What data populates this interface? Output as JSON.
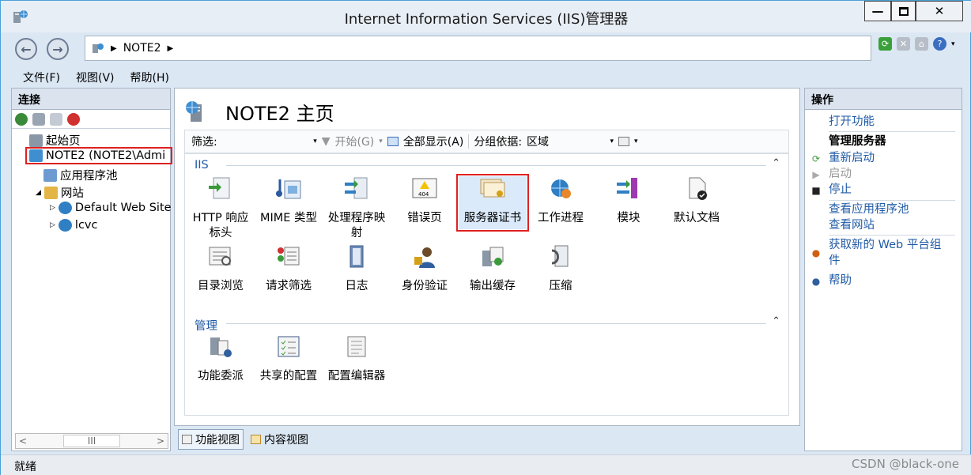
{
  "window": {
    "title": "Internet Information Services (IIS)管理器"
  },
  "nav": {
    "path_item": "NOTE2"
  },
  "menu": [
    "文件(F)",
    "视图(V)",
    "帮助(H)"
  ],
  "connections": {
    "title": "连接",
    "tree": [
      {
        "label": "起始页"
      },
      {
        "label": "NOTE2 (NOTE2\\Admi"
      },
      {
        "label": "应用程序池"
      },
      {
        "label": "网站"
      },
      {
        "label": "Default Web Site"
      },
      {
        "label": "lcvc"
      }
    ],
    "scroll_label": "III"
  },
  "main": {
    "title": "NOTE2 主页",
    "filter": {
      "label": "筛选:",
      "start": "开始(G)",
      "show_all": "全部显示(A)",
      "group_by_label": "分组依据:",
      "group_by_value": "区域"
    },
    "groups": [
      {
        "name": "IIS"
      },
      {
        "name": "管理"
      }
    ],
    "features": [
      {
        "label": "HTTP 响应\n标头",
        "icon": "http-headers-icon"
      },
      {
        "label": "MIME 类型",
        "icon": "mime-types-icon"
      },
      {
        "label": "处理程序映\n射",
        "icon": "handler-mappings-icon"
      },
      {
        "label": "错误页",
        "icon": "error-pages-icon"
      },
      {
        "label": "服务器证书",
        "icon": "server-certificates-icon"
      },
      {
        "label": "工作进程",
        "icon": "worker-processes-icon"
      },
      {
        "label": "模块",
        "icon": "modules-icon"
      },
      {
        "label": "默认文档",
        "icon": "default-document-icon"
      },
      {
        "label": "目录浏览",
        "icon": "directory-browsing-icon"
      },
      {
        "label": "请求筛选",
        "icon": "request-filtering-icon"
      },
      {
        "label": "日志",
        "icon": "logging-icon"
      },
      {
        "label": "身份验证",
        "icon": "authentication-icon"
      },
      {
        "label": "输出缓存",
        "icon": "output-caching-icon"
      },
      {
        "label": "压缩",
        "icon": "compression-icon"
      },
      {
        "label": "功能委派",
        "icon": "feature-delegation-icon"
      },
      {
        "label": "共享的配置",
        "icon": "shared-configuration-icon"
      },
      {
        "label": "配置编辑器",
        "icon": "configuration-editor-icon"
      }
    ],
    "tabs": [
      "功能视图",
      "内容视图"
    ]
  },
  "actions": {
    "title": "操作",
    "items": [
      {
        "label": "打开功能"
      },
      {
        "label": "管理服务器"
      },
      {
        "label": "重新启动"
      },
      {
        "label": "启动"
      },
      {
        "label": "停止"
      },
      {
        "label": "查看应用程序池"
      },
      {
        "label": "查看网站"
      },
      {
        "label": "获取新的 Web 平台组\n件"
      },
      {
        "label": "帮助"
      }
    ]
  },
  "status": {
    "text": "就绪"
  },
  "watermark": "CSDN @black-one"
}
